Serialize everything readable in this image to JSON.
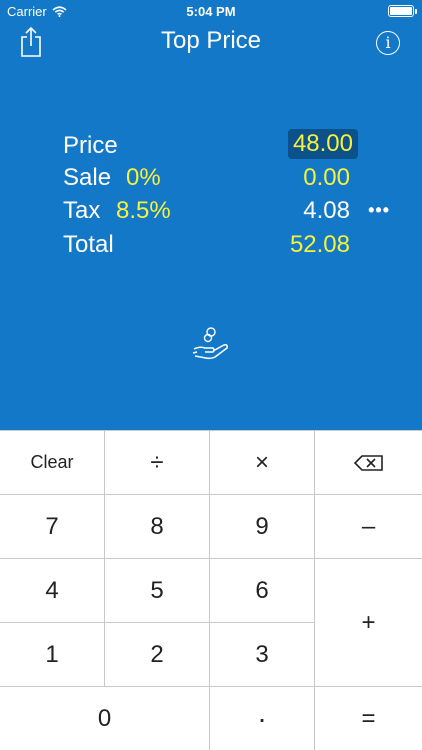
{
  "status_bar": {
    "carrier": "Carrier",
    "time": "5:04 PM"
  },
  "nav": {
    "title": "Top Price",
    "share_icon": "share-icon",
    "info_icon": "info-icon",
    "info_glyph": "i"
  },
  "summary": {
    "price": {
      "label": "Price",
      "value": "48.00"
    },
    "sale": {
      "label": "Sale",
      "percent": "0%",
      "value": "0.00"
    },
    "tax": {
      "label": "Tax",
      "percent": "8.5%",
      "value": "4.08",
      "more": "•••"
    },
    "total": {
      "label": "Total",
      "value": "52.08"
    }
  },
  "keypad": {
    "clear": "Clear",
    "divide": "÷",
    "multiply": "×",
    "seven": "7",
    "eight": "8",
    "nine": "9",
    "minus": "–",
    "four": "4",
    "five": "5",
    "six": "6",
    "plus": "+",
    "one": "1",
    "two": "2",
    "three": "3",
    "zero": "0",
    "dot": "·",
    "equals": "="
  },
  "colors": {
    "background": "#1478c8",
    "highlight": "#0c5189",
    "accent_yellow": "#f6f23c"
  }
}
